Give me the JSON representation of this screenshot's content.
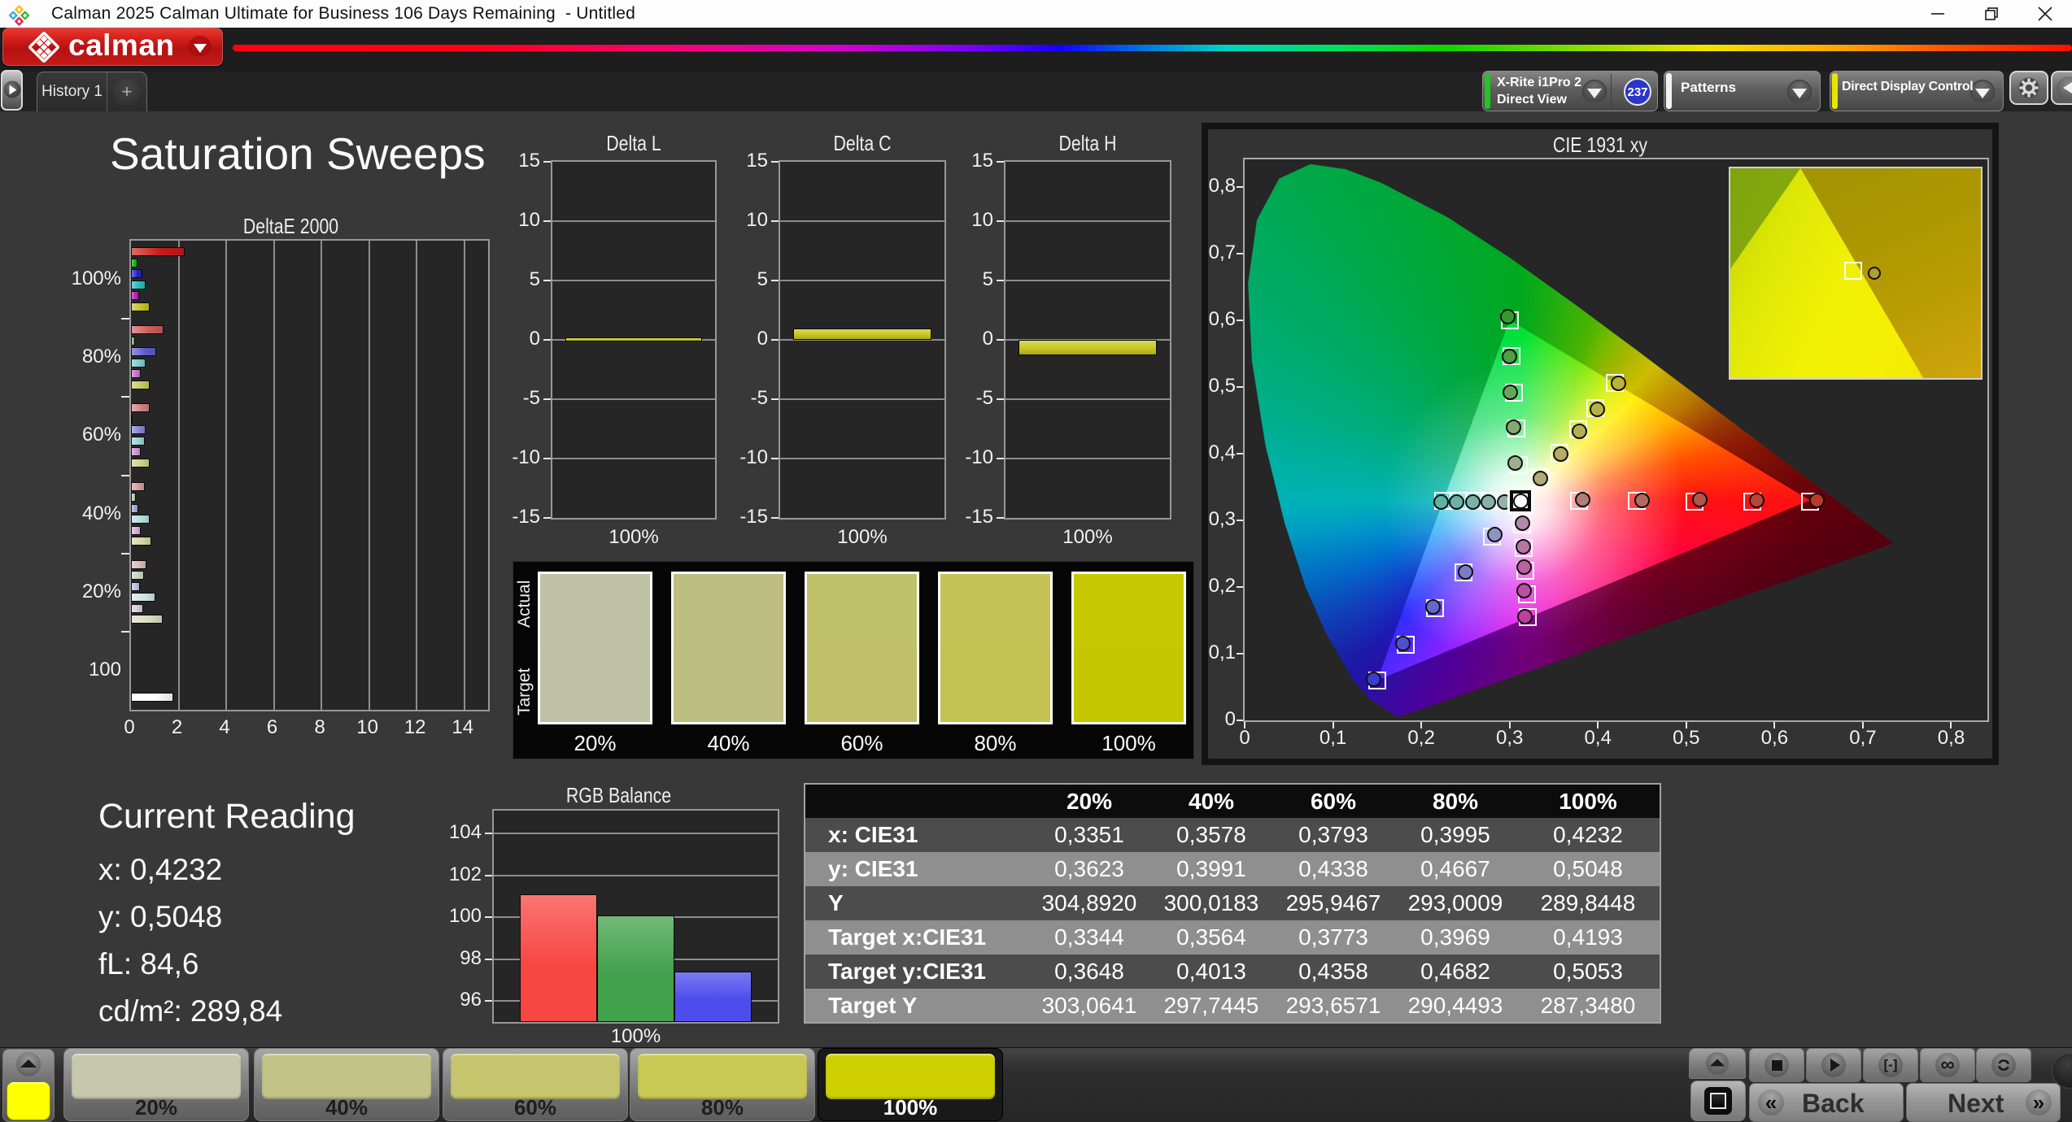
{
  "title_bar": {
    "title": "Calman 2025 Calman Ultimate for Business 106 Days Remaining  - Untitled",
    "window_controls": [
      "minimize",
      "restore",
      "close"
    ]
  },
  "header": {
    "brand": "calman"
  },
  "tab_bar": {
    "tabs": [
      {
        "label": "History 1"
      }
    ],
    "add_label": "+",
    "meter_dropdown": {
      "line1": "X-Rite i1Pro 2",
      "line2": "Direct View",
      "badge": "237",
      "stripe_color": "#21c421"
    },
    "patterns_dropdown": {
      "label": "Patterns",
      "stripe_color": "#f2f2f2"
    },
    "display_control_dropdown": {
      "label": "Direct Display Control",
      "stripe_color": "#e8e400"
    }
  },
  "page": {
    "title": "Saturation Sweeps"
  },
  "current_reading": {
    "title": "Current Reading",
    "items": [
      {
        "label": "x:",
        "value": "0,4232"
      },
      {
        "label": "y:",
        "value": "0,5048"
      },
      {
        "label": "fL:",
        "value": "84,6"
      },
      {
        "label": "cd/m²:",
        "value": "289,84"
      }
    ]
  },
  "chart_data": [
    {
      "id": "deltaE",
      "type": "bar",
      "orientation": "horizontal",
      "title": "DeltaE 2000",
      "xlabel": "",
      "ylabel": "",
      "xlim": [
        0,
        15
      ],
      "xticks": [
        0,
        2,
        4,
        6,
        8,
        10,
        12,
        14
      ],
      "categories": [
        "100%",
        "80%",
        "60%",
        "40%",
        "20%",
        "100"
      ],
      "series_order": [
        "red",
        "green",
        "blue",
        "cyan",
        "magenta",
        "yellow"
      ],
      "groups": [
        {
          "label": "100%",
          "values": [
            2.24,
            0.27,
            0.47,
            0.6,
            0.34,
            0.8
          ],
          "colors": [
            "#c81a1a",
            "#17b617",
            "#2424c8",
            "#28bcbc",
            "#c01cc0",
            "#c2c22a"
          ]
        },
        {
          "label": "80%",
          "values": [
            1.35,
            0.17,
            1.05,
            0.6,
            0.42,
            0.77
          ],
          "colors": [
            "#cd5c5c",
            "#77b877",
            "#5d5dce",
            "#7ccaca",
            "#c873c8",
            "#c8c862"
          ]
        },
        {
          "label": "60%",
          "values": [
            0.8,
            0.08,
            0.6,
            0.58,
            0.4,
            0.8
          ],
          "colors": [
            "#d08080",
            "#9cc49c",
            "#8787d4",
            "#9cd4d4",
            "#ce95ce",
            "#cfcf8a"
          ]
        },
        {
          "label": "40%",
          "values": [
            0.58,
            0.2,
            0.3,
            0.78,
            0.4,
            0.85
          ],
          "colors": [
            "#d49c9c",
            "#b2ceb2",
            "#a5a5da",
            "#b6dede",
            "#d4b0d4",
            "#d6d6a6"
          ]
        },
        {
          "label": "20%",
          "values": [
            0.64,
            0.54,
            0.37,
            1.03,
            0.5,
            1.33
          ],
          "colors": [
            "#d9b9b9",
            "#c6d6c6",
            "#bfbfe2",
            "#cfe4e4",
            "#dbc9db",
            "#dcdcc2"
          ]
        },
        {
          "label": "100",
          "values": [
            null,
            null,
            null,
            null,
            null,
            1.77
          ],
          "colors": [
            null,
            null,
            null,
            null,
            null,
            "#ffffff"
          ]
        }
      ]
    },
    {
      "id": "deltaL",
      "type": "bar",
      "title": "Delta L",
      "categories": [
        "100%"
      ],
      "values": [
        0.18
      ],
      "ylim": [
        -15,
        15
      ],
      "yticks": [
        15,
        10,
        5,
        0,
        -5,
        -10,
        -15
      ],
      "bar_color": "#c6c61e"
    },
    {
      "id": "deltaC",
      "type": "bar",
      "title": "Delta C",
      "categories": [
        "100%"
      ],
      "values": [
        0.95
      ],
      "ylim": [
        -15,
        15
      ],
      "yticks": [
        15,
        10,
        5,
        0,
        -5,
        -10,
        -15
      ],
      "bar_color": "#c6c61e"
    },
    {
      "id": "deltaH",
      "type": "bar",
      "title": "Delta H",
      "categories": [
        "100%"
      ],
      "values": [
        -1.32
      ],
      "ylim": [
        -15,
        15
      ],
      "yticks": [
        15,
        10,
        5,
        0,
        -5,
        -10,
        -15
      ],
      "bar_color": "#c6c61e"
    },
    {
      "id": "swatches",
      "type": "table",
      "title": "Actual vs Target swatches",
      "row_labels": [
        "Actual",
        "Target"
      ],
      "categories": [
        "20%",
        "40%",
        "60%",
        "80%",
        "100%"
      ],
      "actual_colors": [
        "#c0c2a6",
        "#bdbe82",
        "#c0c16b",
        "#c3c455",
        "#c6c802"
      ],
      "target_colors": [
        "#bfc1a4",
        "#bcbd80",
        "#bfc069",
        "#c2c353",
        "#c5c701"
      ]
    },
    {
      "id": "cie",
      "type": "scatter",
      "title": "CIE 1931 xy",
      "xlim": [
        0,
        0.841
      ],
      "ylim": [
        0,
        0.841
      ],
      "xticks": [
        "0",
        "0,1",
        "0,2",
        "0,3",
        "0,4",
        "0,5",
        "0,6",
        "0,7",
        "0,8"
      ],
      "yticks": [
        "0",
        "0,1",
        "0,2",
        "0,3",
        "0,4",
        "0,5",
        "0,6",
        "0,7",
        "0,8"
      ],
      "white_point": {
        "target": [
          0.3127,
          0.329
        ],
        "measured": [
          0.3127,
          0.329
        ],
        "color": "#ffffff"
      },
      "sweeps": [
        {
          "name": "red",
          "targets": [
            [
              0.3782,
              0.3288
            ],
            [
              0.4436,
              0.3286
            ],
            [
              0.5091,
              0.3284
            ],
            [
              0.5745,
              0.3282
            ],
            [
              0.64,
              0.328
            ]
          ],
          "measured": [
            [
              0.383,
              0.3305
            ],
            [
              0.45,
              0.33
            ],
            [
              0.515,
              0.3315
            ],
            [
              0.58,
              0.3295
            ],
            [
              0.648,
              0.33
            ]
          ],
          "colors": [
            "#b27d76",
            "#b36a60",
            "#b5564c",
            "#b64438",
            "#b73a2a"
          ]
        },
        {
          "name": "green",
          "targets": [
            [
              0.3102,
              0.3832
            ],
            [
              0.3076,
              0.4374
            ],
            [
              0.3051,
              0.4916
            ],
            [
              0.3025,
              0.5458
            ],
            [
              0.3,
              0.6
            ]
          ],
          "measured": [
            [
              0.3065,
              0.386
            ],
            [
              0.304,
              0.439
            ],
            [
              0.301,
              0.492
            ],
            [
              0.3,
              0.545
            ],
            [
              0.298,
              0.605
            ]
          ],
          "colors": [
            "#9db08d",
            "#83aa74",
            "#68a45c",
            "#4f9f45",
            "#359a2e"
          ]
        },
        {
          "name": "blue",
          "targets": [
            [
              0.2802,
              0.2752
            ],
            [
              0.2476,
              0.2214
            ],
            [
              0.2151,
              0.1676
            ],
            [
              0.1825,
              0.1138
            ],
            [
              0.15,
              0.06
            ]
          ],
          "measured": [
            [
              0.283,
              0.279
            ],
            [
              0.25,
              0.223
            ],
            [
              0.213,
              0.17
            ],
            [
              0.179,
              0.115
            ],
            [
              0.146,
              0.062
            ]
          ],
          "colors": [
            "#9292c2",
            "#7c7cc6",
            "#6666cb",
            "#5050cf",
            "#3a3ad4"
          ]
        },
        {
          "name": "cyan",
          "targets": [
            [
              0.2951,
              0.329
            ],
            [
              0.2775,
              0.329
            ],
            [
              0.2599,
              0.329
            ],
            [
              0.2423,
              0.329
            ],
            [
              0.2247,
              0.329
            ]
          ],
          "measured": [
            [
              0.294,
              0.327
            ],
            [
              0.276,
              0.327
            ],
            [
              0.258,
              0.327
            ],
            [
              0.24,
              0.327
            ],
            [
              0.222,
              0.327
            ]
          ],
          "colors": [
            "#95b0ab",
            "#88b0a9",
            "#7bb1a8",
            "#6eb1a6",
            "#61b2a4"
          ]
        },
        {
          "name": "magenta",
          "targets": [
            [
              0.3143,
              0.294
            ],
            [
              0.316,
              0.259
            ],
            [
              0.3176,
              0.2241
            ],
            [
              0.3193,
              0.1891
            ],
            [
              0.3209,
              0.1542
            ]
          ],
          "measured": [
            [
              0.315,
              0.296
            ],
            [
              0.3155,
              0.26
            ],
            [
              0.316,
              0.23
            ],
            [
              0.3165,
              0.195
            ],
            [
              0.317,
              0.156
            ]
          ],
          "colors": [
            "#b388ab",
            "#b576a7",
            "#b863a3",
            "#ba519f",
            "#bd3f9b"
          ]
        },
        {
          "name": "yellow",
          "targets": [
            [
              0.3344,
              0.3648
            ],
            [
              0.3564,
              0.4013
            ],
            [
              0.3773,
              0.4358
            ],
            [
              0.3969,
              0.4682
            ],
            [
              0.4193,
              0.5053
            ]
          ],
          "measured": [
            [
              0.3351,
              0.3623
            ],
            [
              0.3578,
              0.3991
            ],
            [
              0.3793,
              0.4338
            ],
            [
              0.3995,
              0.4667
            ],
            [
              0.4232,
              0.5048
            ]
          ],
          "colors": [
            "#b2ab79",
            "#b4ac69",
            "#b7ae59",
            "#b9b04a",
            "#bcb23a"
          ]
        }
      ],
      "inset": {
        "square": [
          0.49,
          0.49
        ],
        "circle": [
          0.575,
          0.5
        ],
        "circle_color": "#b0a030"
      }
    },
    {
      "id": "rgb_balance",
      "type": "bar",
      "title": "RGB Balance",
      "categories": [
        "Red",
        "Green",
        "Blue"
      ],
      "values": [
        101.1,
        100.1,
        97.4
      ],
      "colors": [
        "#f84743",
        "#42a14c",
        "#4d4dee"
      ],
      "ylim": [
        95.0,
        105.1
      ],
      "yticks": [
        104,
        102,
        100,
        98,
        96
      ],
      "xlabel": "100%"
    },
    {
      "id": "stats",
      "type": "table",
      "columns": [
        "",
        "20%",
        "40%",
        "60%",
        "80%",
        "100%"
      ],
      "rows": [
        {
          "label": "x: CIE31",
          "values": [
            "0,3351",
            "0,3578",
            "0,3793",
            "0,3995",
            "0,4232"
          ]
        },
        {
          "label": "y: CIE31",
          "values": [
            "0,3623",
            "0,3991",
            "0,4338",
            "0,4667",
            "0,5048"
          ]
        },
        {
          "label": "Y",
          "values": [
            "304,8920",
            "300,0183",
            "295,9467",
            "293,0009",
            "289,8448"
          ]
        },
        {
          "label": "Target x:CIE31",
          "values": [
            "0,3344",
            "0,3564",
            "0,3773",
            "0,3969",
            "0,4193"
          ]
        },
        {
          "label": "Target y:CIE31",
          "values": [
            "0,3648",
            "0,4013",
            "0,4358",
            "0,4682",
            "0,5053"
          ]
        },
        {
          "label": "Target Y",
          "values": [
            "303,0641",
            "297,7445",
            "293,6571",
            "290,4493",
            "287,3480"
          ]
        }
      ]
    }
  ],
  "bottom_bar": {
    "current_swatch_color": "#ffff00",
    "samples": [
      {
        "label": "20%",
        "color": "#c6c8ac",
        "selected": false
      },
      {
        "label": "40%",
        "color": "#c2c387",
        "selected": false
      },
      {
        "label": "60%",
        "color": "#c4c56c",
        "selected": false
      },
      {
        "label": "80%",
        "color": "#c8c954",
        "selected": false
      },
      {
        "label": "100%",
        "color": "#ced001",
        "selected": true
      }
    ],
    "transport": [
      "stop",
      "play",
      "range",
      "infinity",
      "loop"
    ],
    "back_label": "Back",
    "next_label": "Next"
  }
}
